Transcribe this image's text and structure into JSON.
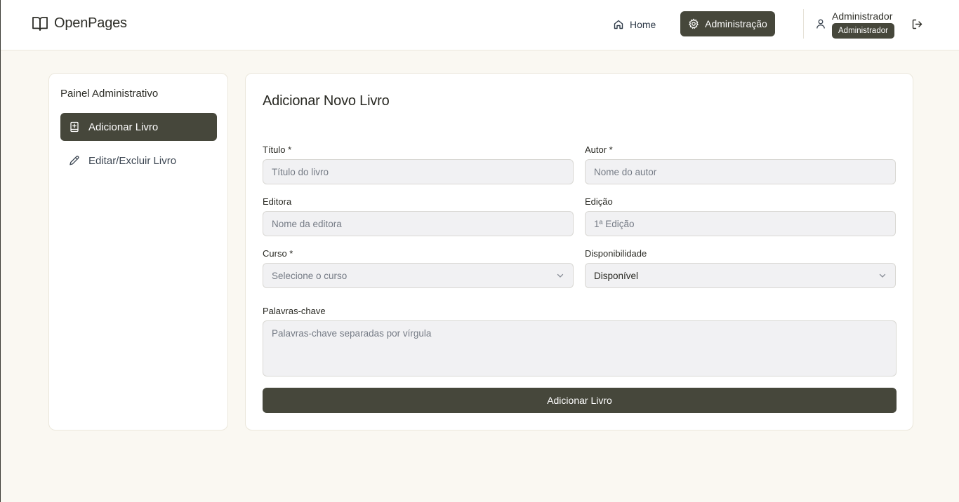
{
  "header": {
    "brand": "OpenPages",
    "nav": {
      "home": "Home",
      "admin": "Administração"
    },
    "user": {
      "name": "Administrador",
      "role": "Administrador"
    }
  },
  "sidebar": {
    "title": "Painel Administrativo",
    "items": [
      {
        "label": "Adicionar Livro",
        "icon": "book-plus-icon",
        "active": true
      },
      {
        "label": "Editar/Excluir Livro",
        "icon": "pencil-icon",
        "active": false
      }
    ]
  },
  "form": {
    "title": "Adicionar Novo Livro",
    "titulo": {
      "label": "Título *",
      "placeholder": "Título do livro",
      "value": ""
    },
    "autor": {
      "label": "Autor *",
      "placeholder": "Nome do autor",
      "value": ""
    },
    "editora": {
      "label": "Editora",
      "placeholder": "Nome da editora",
      "value": ""
    },
    "edicao": {
      "label": "Edição",
      "placeholder": "1ª Edição",
      "value": ""
    },
    "curso": {
      "label": "Curso *",
      "placeholder": "Selecione o curso"
    },
    "disponibilidade": {
      "label": "Disponibilidade",
      "value": "Disponível"
    },
    "palavras": {
      "label": "Palavras-chave",
      "placeholder": "Palavras-chave separadas por vírgula"
    },
    "submit": "Adicionar Livro"
  },
  "colors": {
    "accent": "#46473b",
    "background": "#faf8f2",
    "input_bg": "#f1f1f3"
  }
}
